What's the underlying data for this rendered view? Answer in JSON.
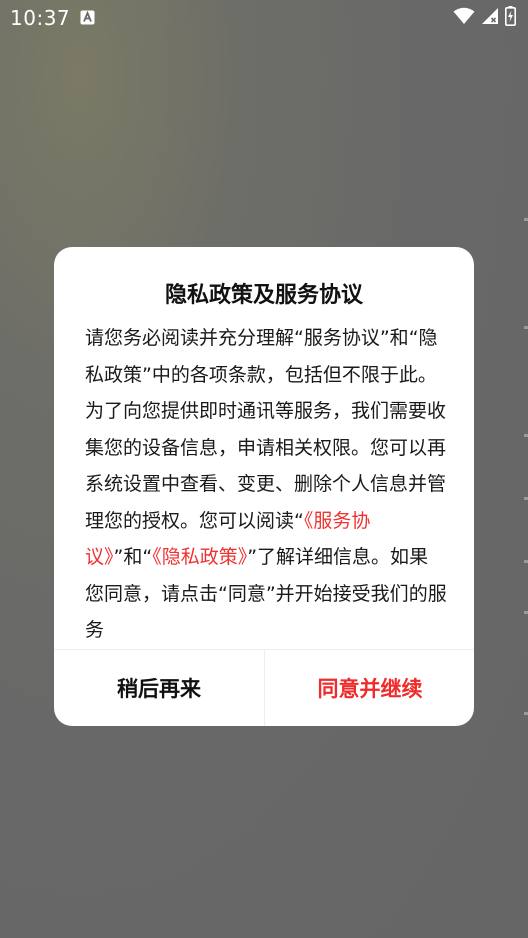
{
  "status_bar": {
    "time": "10:37",
    "icons": [
      "a-notification-icon",
      "wifi-icon",
      "signal-icon",
      "battery-icon"
    ]
  },
  "dialog": {
    "title": "隐私政策及服务协议",
    "body": {
      "text_1": "请您务必阅读并充分理解“服务协议”和“隐私政策”中的各项条款，包括但不限于此。为了向您提供即时通讯等服务，我们需要收集您的设备信息，申请相关权限。您可以再系统设置中查看、变更、删除个人信息并管理您的授权。您可以阅读“",
      "link_service": "《服务协议》",
      "text_2": "”和“",
      "link_privacy": "《隐私政策》",
      "text_3": "”了解详细信息。如果您同意，请点击“同意”并开始接受我们的服务"
    },
    "buttons": {
      "later": "稍后再来",
      "agree": "同意并继续"
    }
  },
  "colors": {
    "link": "#ef3131",
    "agree_button": "#ef2b2b",
    "overlay": "#676767",
    "dialog_bg": "#ffffff"
  }
}
